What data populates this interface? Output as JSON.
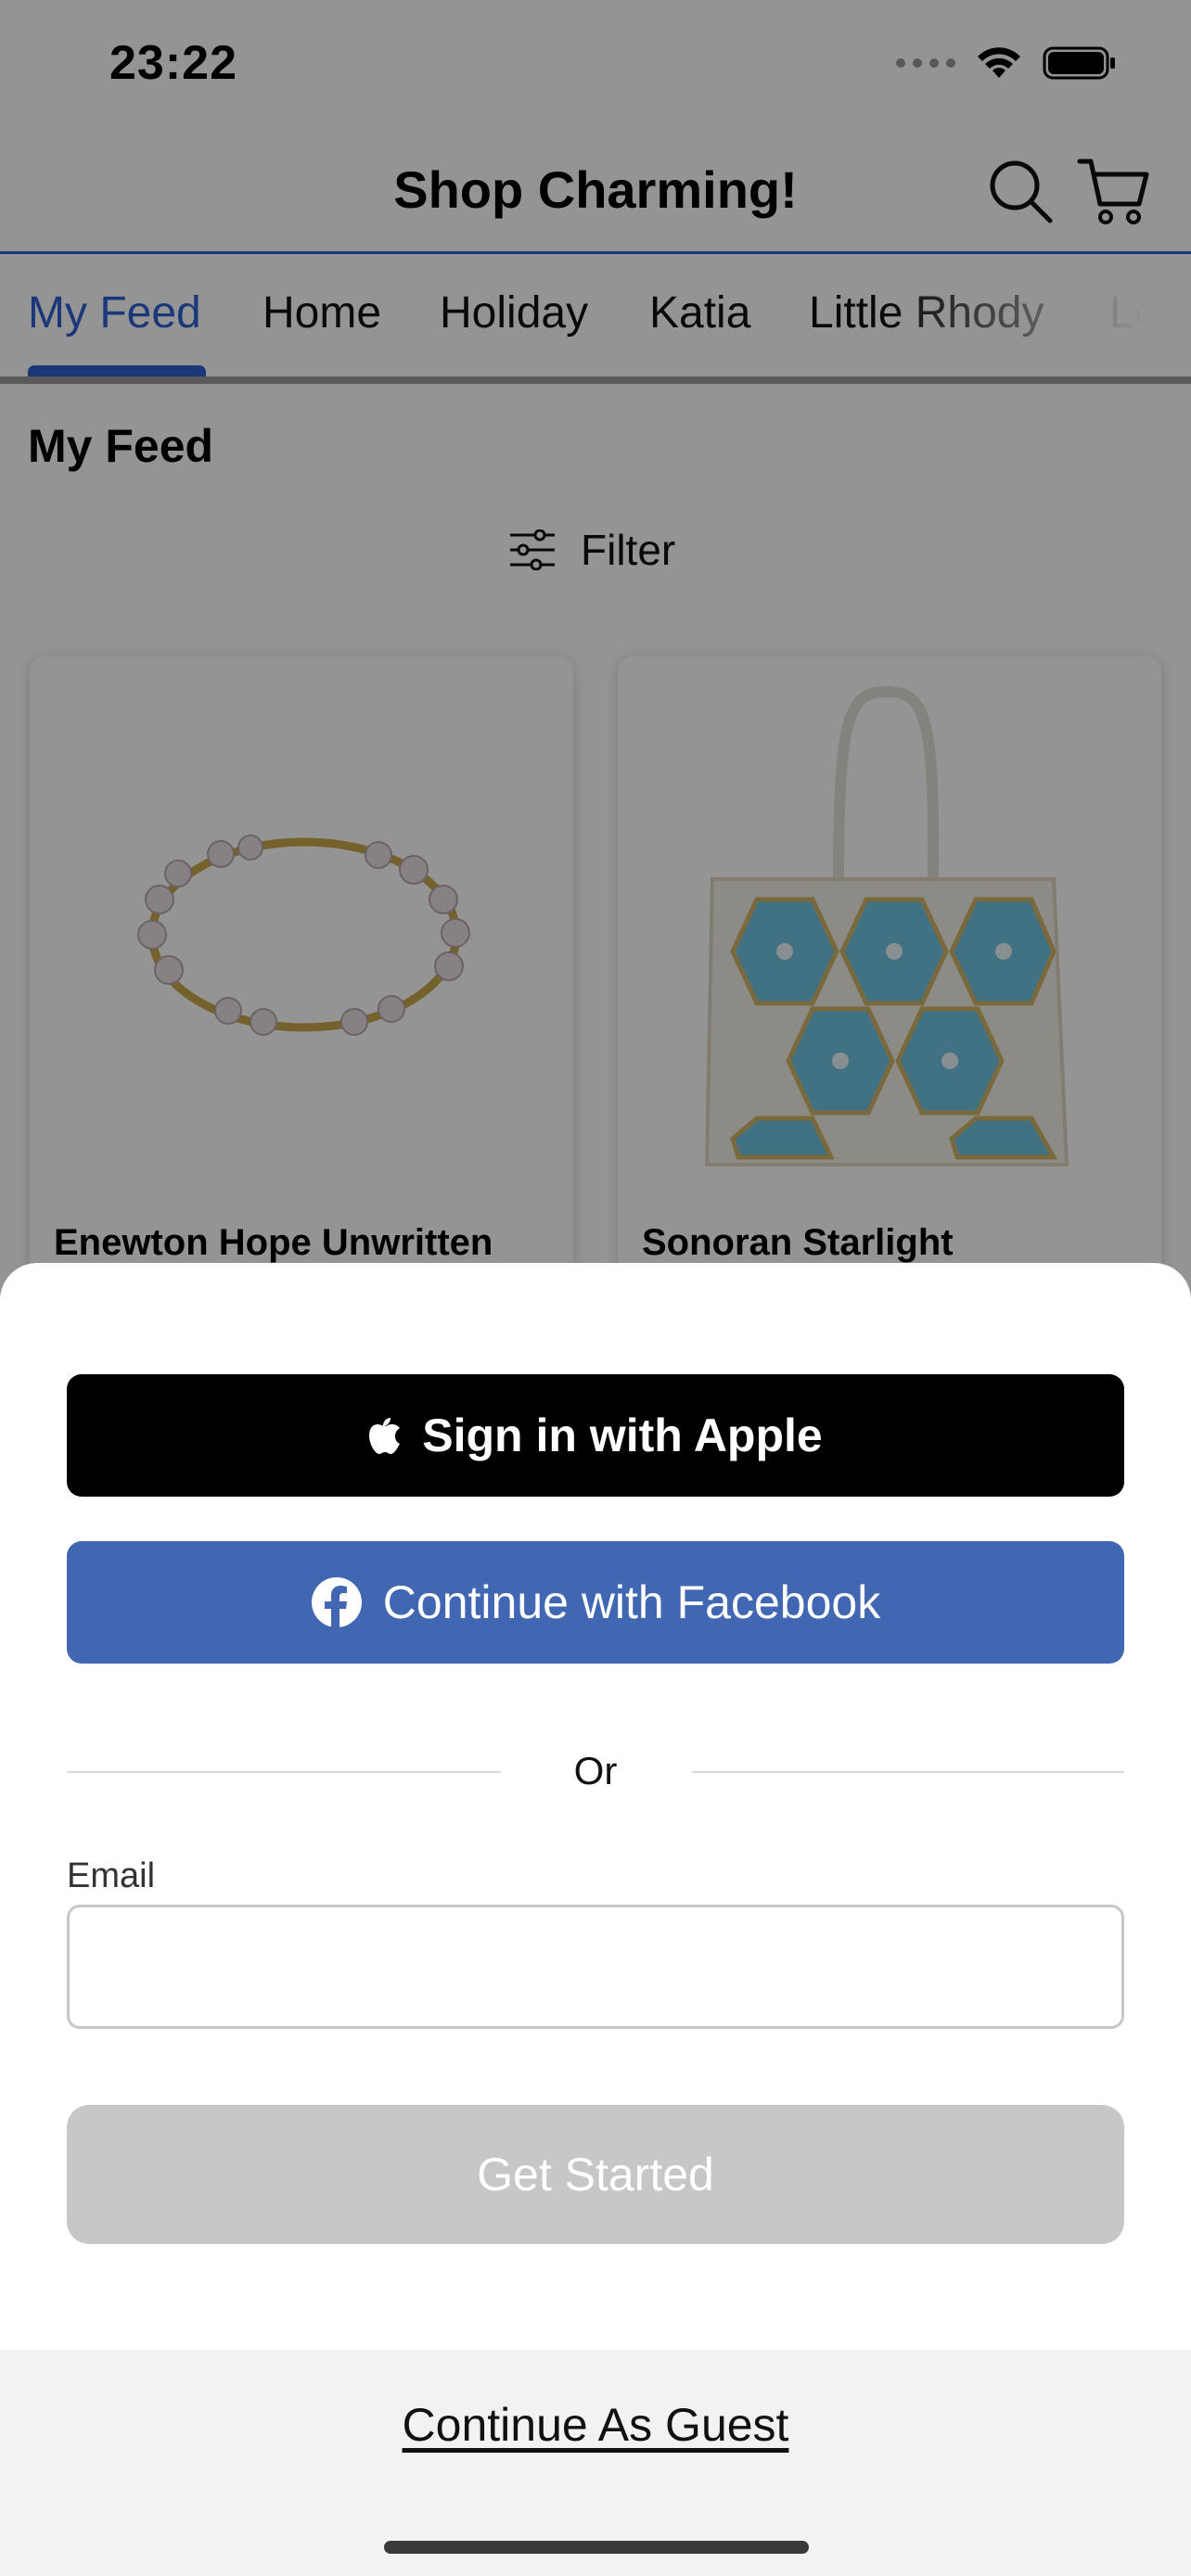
{
  "status_bar": {
    "time": "23:22",
    "icons": [
      "signal-dots-icon",
      "wifi-icon",
      "battery-icon"
    ]
  },
  "header": {
    "title": "Shop Charming!",
    "icons": [
      "search-icon",
      "cart-icon"
    ],
    "accent_color": "#2e5fd0"
  },
  "tabs": [
    {
      "label": "My Feed",
      "active": true
    },
    {
      "label": "Home",
      "active": false
    },
    {
      "label": "Holiday",
      "active": false
    },
    {
      "label": "Katia",
      "active": false
    },
    {
      "label": "Little Rhody",
      "active": false
    },
    {
      "label": "Lo",
      "active": false
    }
  ],
  "feed": {
    "title": "My Feed",
    "filter_label": "Filter",
    "products": [
      {
        "name": "Enewton Hope Unwritten",
        "image": "pearl-bracelet"
      },
      {
        "name": "Sonoran Starlight",
        "image": "blue-tote-bag"
      }
    ]
  },
  "sign_in_sheet": {
    "apple_button": "Sign in with Apple",
    "facebook_button": "Continue with Facebook",
    "divider_text": "Or",
    "email_label": "Email",
    "email_value": "",
    "email_placeholder": "",
    "get_started_button": "Get Started",
    "guest_link": "Continue As Guest",
    "colors": {
      "apple": "#000000",
      "facebook": "#4267b2",
      "disabled": "#c7c7c7"
    }
  }
}
